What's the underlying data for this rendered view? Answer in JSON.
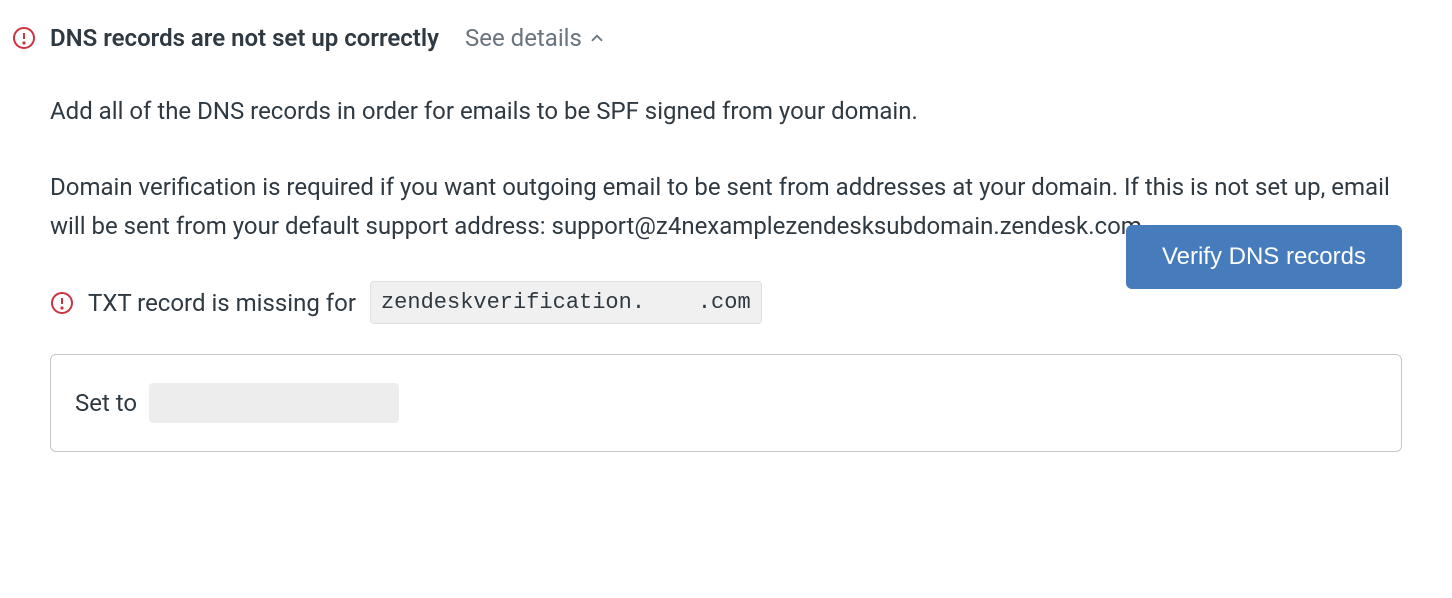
{
  "header": {
    "title": "DNS records are not set up correctly",
    "see_details_label": "See details"
  },
  "body": {
    "paragraph1": "Add all of the DNS records in order for emails to be SPF signed from your domain.",
    "paragraph2": "Domain verification is required if you want outgoing email to be sent from addresses at your domain. If this is not set up, email will be sent from your default support address: support@z4nexamplezendesksubdomain.zendesk.com."
  },
  "txt_record": {
    "missing_text": "TXT record is missing for",
    "domain_value": "zendeskverification.    .com"
  },
  "verify_button_label": "Verify DNS records",
  "set_to": {
    "label": "Set to",
    "value": ""
  }
}
